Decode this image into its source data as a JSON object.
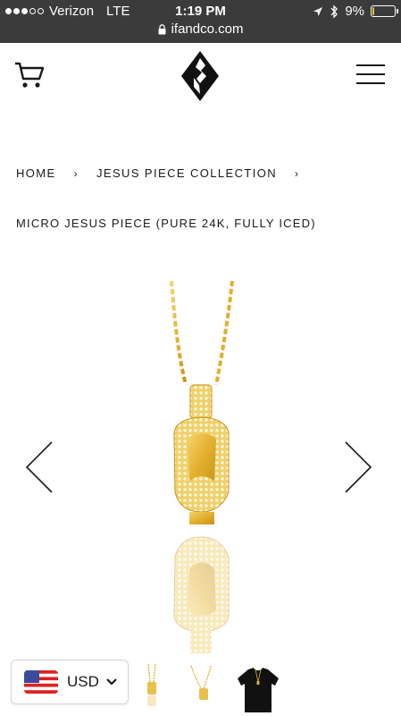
{
  "status_bar": {
    "carrier": "Verizon",
    "network": "LTE",
    "time": "1:19 PM",
    "battery_percent": "9%",
    "battery_level": 0.09,
    "url": "ifandco.com"
  },
  "header": {
    "cart_icon": "cart-icon",
    "logo_icon": "brand-logo",
    "menu_icon": "hamburger-menu-icon"
  },
  "breadcrumb": {
    "home": "HOME",
    "separator": "›",
    "collection": "JESUS PIECE COLLECTION"
  },
  "product": {
    "title": "MICRO JESUS PIECE (PURE 24K, FULLY ICED)"
  },
  "currency": {
    "code": "USD"
  },
  "colors": {
    "status_bar": "#3b3b3b",
    "gold": "#e3b02e",
    "text": "#1a1a1a"
  }
}
